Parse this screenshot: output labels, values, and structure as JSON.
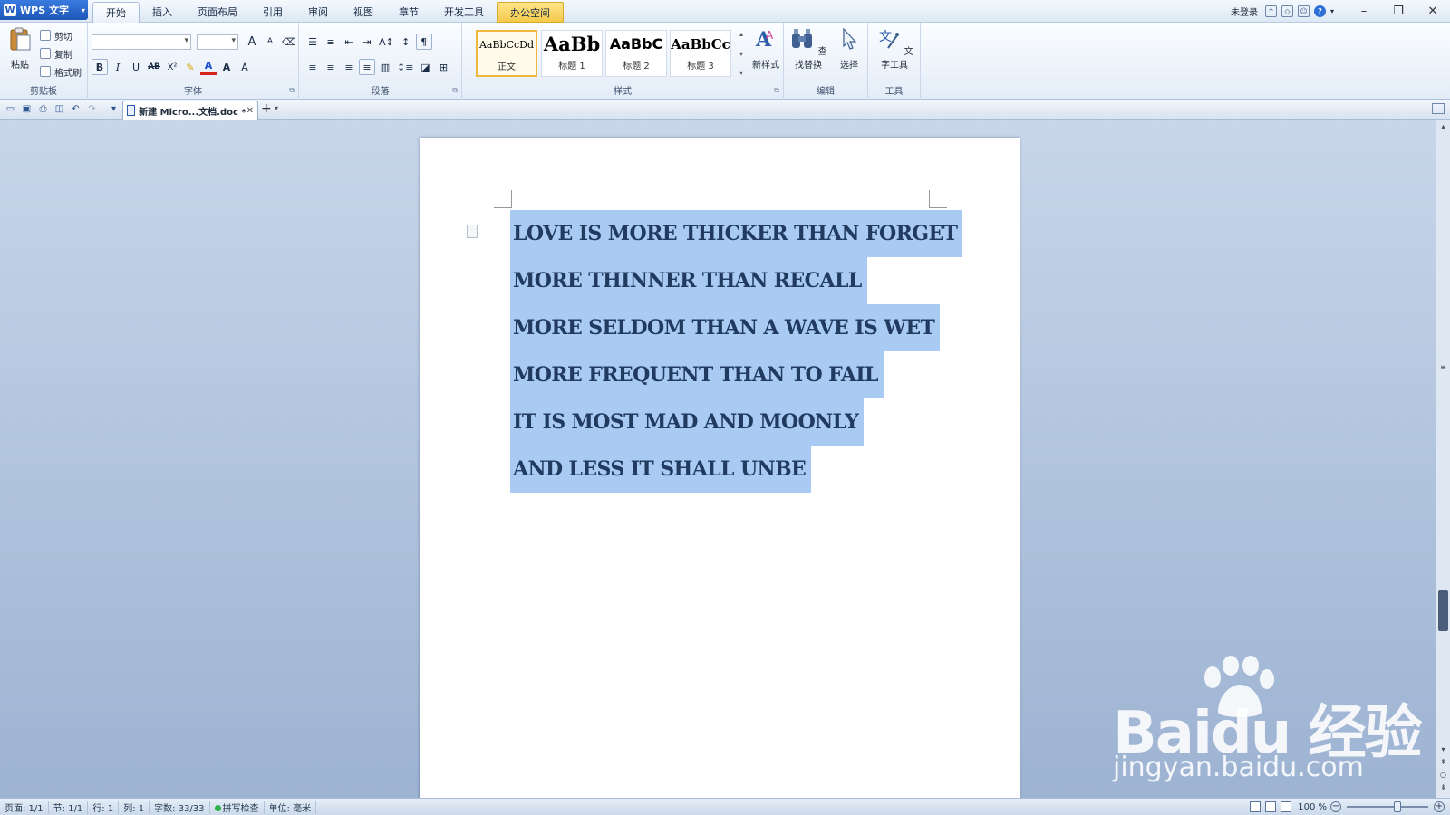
{
  "app": {
    "name": "WPS 文字",
    "logo": "W"
  },
  "tabs": [
    "开始",
    "插入",
    "页面布局",
    "引用",
    "审阅",
    "视图",
    "章节",
    "开发工具",
    "办公空间"
  ],
  "active_tab_index": 0,
  "highlight_tab_index": 8,
  "account": {
    "login_label": "未登录"
  },
  "ribbon": {
    "clipboard": {
      "label": "剪贴板",
      "paste": "粘贴",
      "cut": "剪切",
      "copy": "复制",
      "format_painter": "格式刷"
    },
    "font": {
      "label": "字体",
      "bold": "B",
      "italic": "I",
      "underline": "U",
      "strike": "AB",
      "superscript": "X²",
      "grow": "A",
      "shrink": "A"
    },
    "paragraph": {
      "label": "段落"
    },
    "styles": {
      "label": "样式",
      "items": [
        {
          "sample": "AaBbCcDd",
          "name": "正文"
        },
        {
          "sample": "AaBb",
          "name": "标题 1"
        },
        {
          "sample": "AaBbC",
          "name": "标题 2"
        },
        {
          "sample": "AaBbCc",
          "name": "标题 3"
        }
      ],
      "new_style": "新样式"
    },
    "editing": {
      "label": "编辑",
      "find_replace": "查找替换",
      "select": "选择"
    },
    "tools": {
      "label": "工具",
      "text_tools": "文字工具"
    }
  },
  "document_tab": {
    "title": "新建 Micro...文档.doc *"
  },
  "document": {
    "lines": [
      "LOVE IS MORE THICKER THAN FORGET",
      "MORE THINNER THAN RECALL",
      "MORE SELDOM THAN A WAVE IS WET",
      "MORE FREQUENT THAN TO FAIL",
      "IT IS MOST MAD AND MOONLY",
      "AND LESS IT SHALL UNBE"
    ],
    "selection_color": "#a9cbf3"
  },
  "status": {
    "page": "页面: 1/1",
    "section": "节: 1/1",
    "row": "行: 1",
    "column": "列: 1",
    "word_count": "字数: 33/33",
    "spell_check": "拼写检查",
    "unit": "单位: 毫米",
    "zoom": "100 %"
  },
  "watermark": {
    "brand": "Bai",
    "brand_suffix": "du 经验",
    "url": "jingyan.baidu.com"
  },
  "colors": {
    "accent": "#1d57b8",
    "highlight_tab": "#f3c94a",
    "workspace": "#a9bcd6"
  }
}
